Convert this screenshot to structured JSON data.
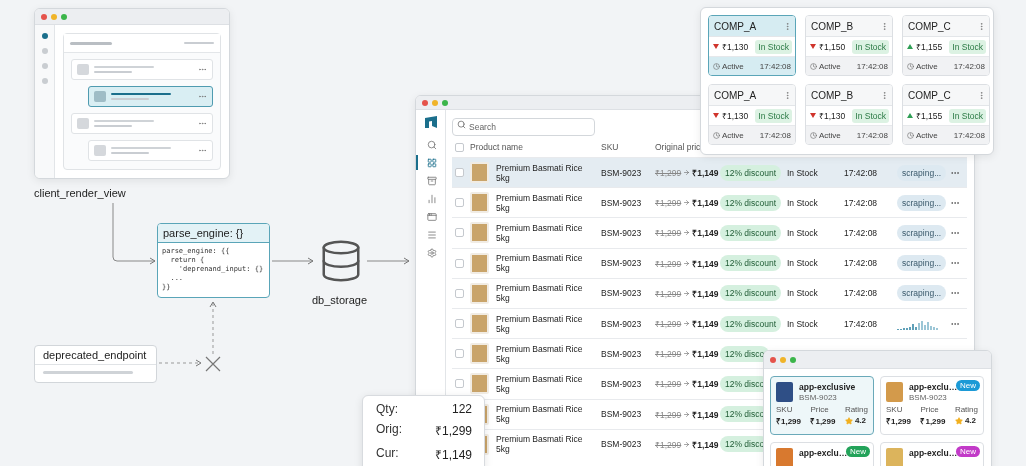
{
  "client_view": {
    "label": "client_render_view",
    "nav": [
      {
        "selected": true
      },
      {
        "selected": false
      },
      {
        "selected": false
      },
      {
        "selected": false
      }
    ],
    "items": [
      {
        "selected": false,
        "children": [
          {
            "selected": true
          }
        ]
      },
      {
        "selected": false,
        "children": [
          {
            "selected": false
          }
        ]
      }
    ]
  },
  "parse_engine": {
    "title": "parse_engine: {}",
    "code": "parse_engine: {{\n  return {\n    'deprenand_input: {}\n  ...\n}}"
  },
  "storage": {
    "label": "db_storage"
  },
  "deprecated": {
    "label": "deprecated_endpoint",
    "blocked": true
  },
  "table_window": {
    "nav": [
      {
        "selected": false
      },
      {
        "selected": true
      },
      {
        "selected": false
      },
      {
        "selected": false
      },
      {
        "selected": false
      },
      {
        "selected": false
      },
      {
        "selected": false
      }
    ],
    "search": {
      "placeholder": "Search"
    },
    "header_checked": false,
    "columns": [
      "Product name",
      "SKU",
      "Original pric"
    ],
    "rows": [
      {
        "checked": false,
        "selected": true,
        "name": "Premium Basmati Rice 5kg",
        "sku": "BSM-9023",
        "original": "₹1,299",
        "current": "₹1,149",
        "discount": "12% discount",
        "stock": "In Stock",
        "time": "17:42:08",
        "status": {
          "kind": "scraping",
          "label": "scraping..."
        }
      },
      {
        "checked": false,
        "selected": false,
        "name": "Premium Basmati Rice 5kg",
        "sku": "BSM-9023",
        "original": "₹1,299",
        "current": "₹1,149",
        "discount": "12% discount",
        "stock": "In Stock",
        "time": "17:42:08",
        "status": {
          "kind": "scraping",
          "label": "scraping..."
        }
      },
      {
        "checked": false,
        "selected": false,
        "name": "Premium Basmati Rice 5kg",
        "sku": "BSM-9023",
        "original": "₹1,299",
        "current": "₹1,149",
        "discount": "12% discount",
        "stock": "In Stock",
        "time": "17:42:08",
        "status": {
          "kind": "scraping",
          "label": "scraping..."
        }
      },
      {
        "checked": false,
        "selected": false,
        "name": "Premium Basmati Rice 5kg",
        "sku": "BSM-9023",
        "original": "₹1,299",
        "current": "₹1,149",
        "discount": "12% discount",
        "stock": "In Stock",
        "time": "17:42:08",
        "status": {
          "kind": "scraping",
          "label": "scraping..."
        }
      },
      {
        "checked": false,
        "selected": false,
        "name": "Premium Basmati Rice 5kg",
        "sku": "BSM-9023",
        "original": "₹1,299",
        "current": "₹1,149",
        "discount": "12% discount",
        "stock": "In Stock",
        "time": "17:42:08",
        "status": {
          "kind": "scraping",
          "label": "scraping..."
        }
      },
      {
        "checked": false,
        "selected": false,
        "name": "Premium Basmati Rice 5kg",
        "sku": "BSM-9023",
        "original": "₹1,299",
        "current": "₹1,149",
        "discount": "12% discount",
        "stock": "In Stock",
        "time": "17:42:08",
        "status": {
          "kind": "sparkline"
        }
      },
      {
        "checked": false,
        "selected": false,
        "name": "Premium Basmati Rice 5kg",
        "sku": "BSM-9023",
        "original": "₹1,299",
        "current": "₹1,149",
        "discount": "12% disco"
      },
      {
        "checked": false,
        "selected": false,
        "name": "Premium Basmati Rice 5kg",
        "sku": "BSM-9023",
        "original": "₹1,299",
        "current": "₹1,149",
        "discount": "12% disco"
      },
      {
        "selected": false,
        "name": "Premium Basmati Rice 5kg",
        "sku": "BSM-9023",
        "original": "₹1,299",
        "current": "₹1,149",
        "discount": "12% disco"
      },
      {
        "selected": false,
        "name": "Premium Basmati Rice 5kg",
        "sku": "BSM-9023",
        "original": "₹1,299",
        "current": "₹1,149",
        "discount": "12% disco"
      }
    ]
  },
  "competitors": {
    "cards": [
      {
        "name": "COMP_A",
        "price_down": true,
        "price": "₹1,130",
        "stock": "In Stock",
        "status": "Active",
        "time": "17:42:08",
        "selected": true
      },
      {
        "name": "COMP_B",
        "price_down": true,
        "price": "₹1,150",
        "stock": "In Stock",
        "status": "Active",
        "time": "17:42:08",
        "selected": false
      },
      {
        "name": "COMP_C",
        "price_down": false,
        "price": "₹1,155",
        "stock": "In Stock",
        "status": "Active",
        "time": "17:42:08",
        "selected": false
      },
      {
        "name": "COMP_A",
        "price_down": true,
        "price": "₹1,130",
        "stock": "In Stock",
        "status": "Active",
        "time": "17:42:08",
        "selected": false
      },
      {
        "name": "COMP_B",
        "price_down": true,
        "price": "₹1,130",
        "stock": "In Stock",
        "status": "Active",
        "time": "17:42:08",
        "selected": false
      },
      {
        "name": "COMP_C",
        "price_down": false,
        "price": "₹1,155",
        "stock": "In Stock",
        "status": "Active",
        "time": "17:42:08",
        "selected": false
      }
    ]
  },
  "app_window": {
    "cards": [
      {
        "name": "app-exclusive",
        "sku": "BSM-9023",
        "labels": [
          "SKU",
          "Price",
          "Rating"
        ],
        "values": [
          "₹1,299",
          "₹1,299"
        ],
        "rating": "4.2",
        "selected": true
      },
      {
        "name": "app-exclu…",
        "sku": "BSM-9023",
        "badge": {
          "label": "New",
          "color": "#1c9ad6"
        },
        "labels": [
          "SKU",
          "Price",
          "Rating"
        ],
        "values": [
          "₹1,299",
          "₹1,299"
        ],
        "rating": "4.2",
        "selected": false
      },
      {
        "name": "app-exclu…",
        "badge": {
          "label": "New",
          "color": "#23a35a"
        },
        "selected": false
      },
      {
        "name": "app-exclu…",
        "badge": {
          "label": "New",
          "color": "#c23ac8"
        },
        "selected": false
      }
    ]
  },
  "tooltip": {
    "rows": [
      {
        "label": "Qty:",
        "value": "122"
      },
      {
        "label": "Orig:",
        "value": "₹1,299"
      },
      {
        "label": "Cur:",
        "value": "₹1,149"
      }
    ]
  }
}
